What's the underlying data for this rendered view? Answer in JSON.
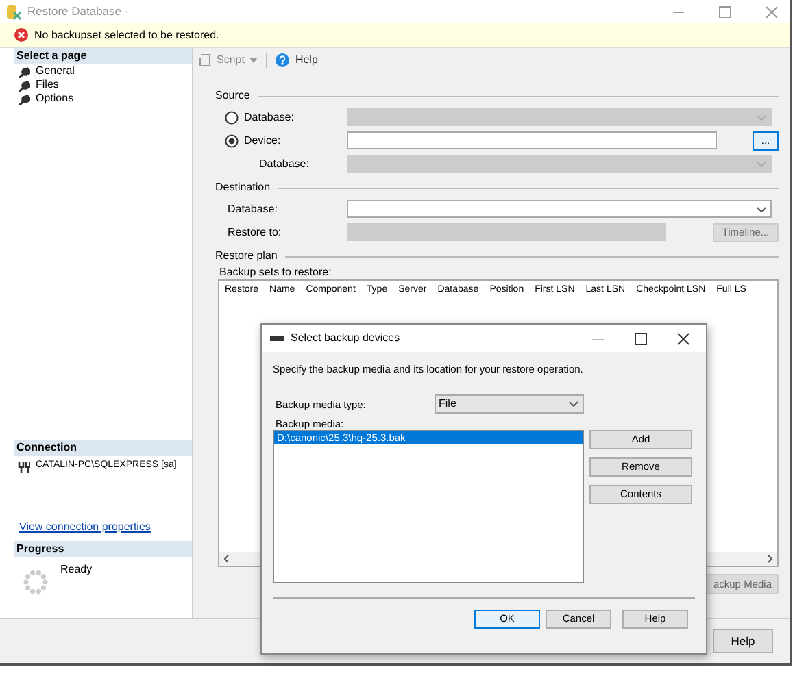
{
  "window": {
    "title": "Restore Database -"
  },
  "message": {
    "kind": "error",
    "text": "No backupset selected to be restored."
  },
  "sidebar": {
    "select_page": {
      "title": "Select a page",
      "items": [
        {
          "label": "General",
          "selected": true
        },
        {
          "label": "Files",
          "selected": false
        },
        {
          "label": "Options",
          "selected": false
        }
      ]
    },
    "connection": {
      "title": "Connection",
      "server": "CATALIN-PC\\SQLEXPRESS [sa]",
      "link": "View connection properties"
    },
    "progress": {
      "title": "Progress",
      "status": "Ready"
    }
  },
  "toolbar": {
    "script": {
      "label": "Script",
      "disabled": true
    },
    "help": "Help"
  },
  "source": {
    "title": "Source",
    "options": [
      {
        "label": "Database:",
        "selected": false,
        "disabled": true
      },
      {
        "label": "Device:",
        "selected": true,
        "disabled": false
      }
    ],
    "device_button": "...",
    "database_label": "Database:",
    "database_disabled": true
  },
  "destination": {
    "title": "Destination",
    "database_label": "Database:",
    "database_disabled": false,
    "restore_to_label": "Restore to:",
    "restore_to_disabled": true,
    "timeline_button": {
      "label": "Timeline...",
      "disabled": true
    }
  },
  "restore_plan": {
    "title": "Restore plan",
    "sets_label": "Backup sets to restore:",
    "columns": [
      "Restore",
      "Name",
      "Component",
      "Type",
      "Server",
      "Database",
      "Position",
      "First LSN",
      "Last LSN",
      "Checkpoint LSN",
      "Full LS"
    ],
    "verify_button": {
      "label": "ackup Media",
      "disabled": true
    }
  },
  "footer": {
    "help_button": "Help"
  },
  "dialog": {
    "title": "Select backup devices",
    "description": "Specify the backup media and its location for your restore operation.",
    "media_type_label": "Backup media type:",
    "media_type": "File",
    "media_label": "Backup media:",
    "media": [
      {
        "path": "D:\\canonic\\25.3\\hq-25.3.bak",
        "selected": true
      }
    ],
    "side_buttons": [
      "Add",
      "Remove",
      "Contents"
    ],
    "buttons": [
      {
        "label": "OK",
        "default": true
      },
      {
        "label": "Cancel",
        "default": false
      },
      {
        "label": "Help",
        "default": false
      }
    ]
  }
}
